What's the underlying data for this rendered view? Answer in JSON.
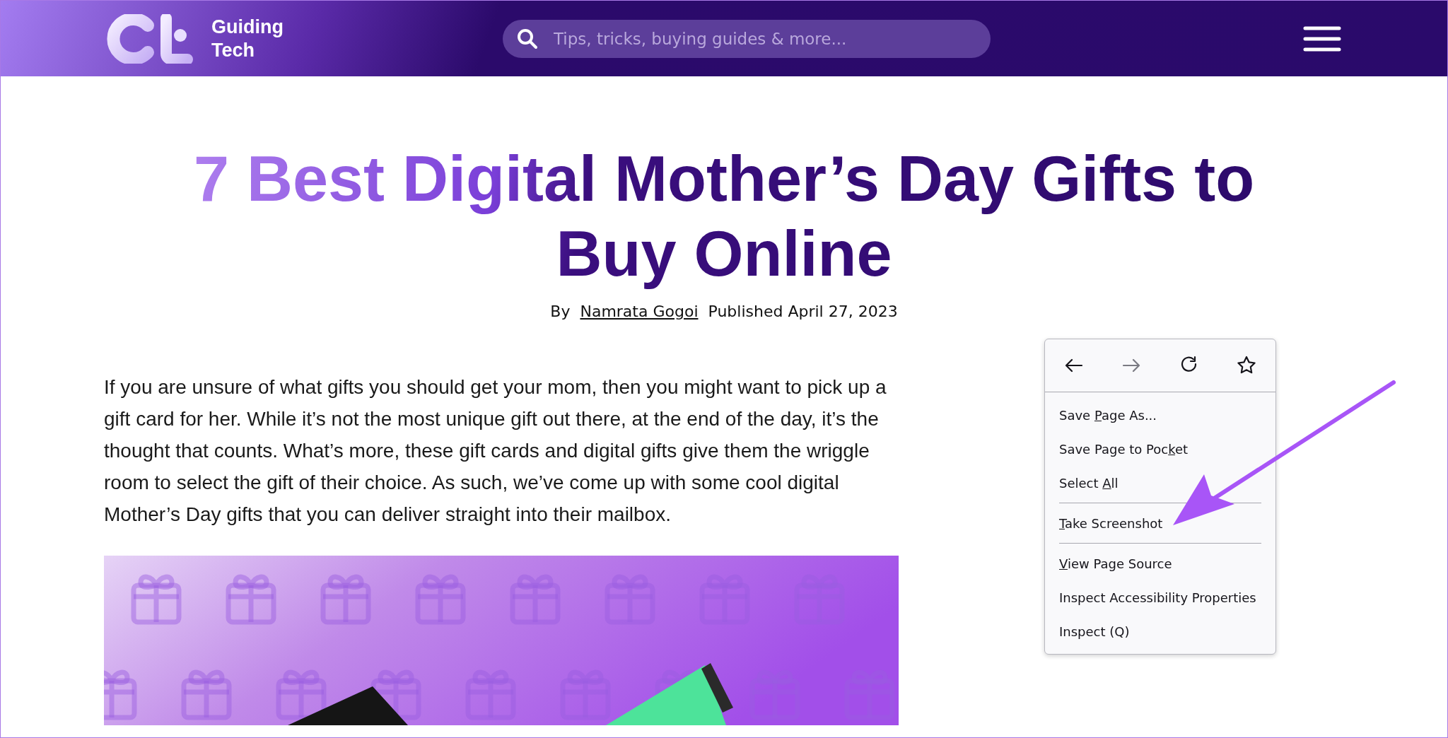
{
  "header": {
    "logo_text": "Guiding Tech",
    "search": {
      "placeholder": "Tips, tricks, buying guides & more..."
    }
  },
  "article": {
    "title": "7 Best Digital Mother’s Day Gifts to Buy Online",
    "byline": {
      "prefix": "By",
      "author": "Namrata Gogoi",
      "published": "Published April 27, 2023"
    },
    "intro": "If you are unsure of what gifts you should get your mom, then you might want to pick up a gift card for her. While it’s not the most unique gift out there, at the end of the day, it’s the thought that counts. What’s more, these gift cards and digital gifts give them the wriggle room to select the gift of their choice. As such, we’ve come up with some cool digital Mother’s Day gifts that you can deliver straight into their mailbox."
  },
  "context_menu": {
    "nav": [
      {
        "kind": "back",
        "disabled": false
      },
      {
        "kind": "forward",
        "disabled": true
      },
      {
        "kind": "reload",
        "disabled": false
      },
      {
        "kind": "bookmark",
        "disabled": false
      }
    ],
    "items": [
      {
        "kind": "item",
        "before": "Save ",
        "access_key": "P",
        "after": "age As..."
      },
      {
        "kind": "item",
        "before": "Save Page to Poc",
        "access_key": "k",
        "after": "et"
      },
      {
        "kind": "item",
        "before": "Select ",
        "access_key": "A",
        "after": "ll"
      },
      {
        "kind": "separator"
      },
      {
        "kind": "item",
        "access_key": "T",
        "after": "ake Screenshot"
      },
      {
        "kind": "separator"
      },
      {
        "kind": "item",
        "access_key": "V",
        "after": "iew Page Source"
      },
      {
        "kind": "item",
        "before": "Inspect Accessibility Properties"
      },
      {
        "kind": "item",
        "before": "Inspect (Q)"
      }
    ]
  }
}
